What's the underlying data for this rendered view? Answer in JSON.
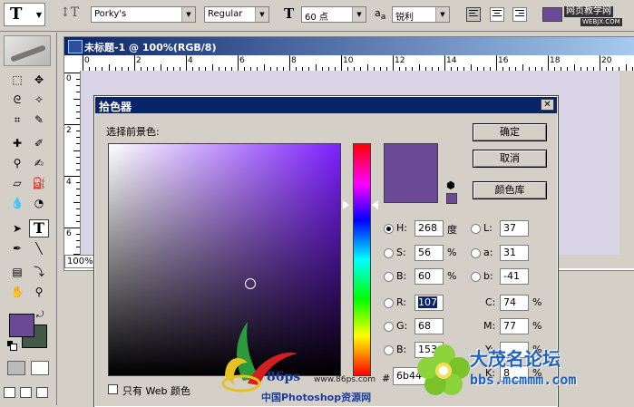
{
  "options_bar": {
    "font_family": "Porky's",
    "font_style": "Regular",
    "font_size": "60 点",
    "antialias": "锐利",
    "text_color": "#6a4a96"
  },
  "watermarks": {
    "top_right": "网页教学网",
    "top_right_url": "WEBJX.COM",
    "ps86_url": "www.86ps.com",
    "ps86_logo": "86ps",
    "ps86_cn": "中国Photoshop资源网",
    "forum_name": "大茂名论坛",
    "forum_url": "bbs.mcmmm.com"
  },
  "document": {
    "title": "未标题-1 @ 100%(RGB/8)",
    "zoom": "100%",
    "ruler_h": [
      "0",
      "2",
      "4",
      "6",
      "8",
      "10",
      "12",
      "14",
      "16",
      "18",
      "20"
    ],
    "ruler_v": [
      "0",
      "2",
      "4",
      "6"
    ]
  },
  "tools": {
    "foreground": "#6a4a96",
    "background": "#44584a"
  },
  "color_picker": {
    "title": "拾色器",
    "prompt": "选择前景色:",
    "ok": "确定",
    "cancel": "取消",
    "libraries": "颜色库",
    "web_only": "只有 Web 颜色",
    "hex_label": "#",
    "hex": "6b44",
    "new_color": "#6a4a96",
    "hsb": [
      {
        "label": "H:",
        "value": "268",
        "unit": "度",
        "selected": true
      },
      {
        "label": "S:",
        "value": "56",
        "unit": "%",
        "selected": false
      },
      {
        "label": "B:",
        "value": "60",
        "unit": "%",
        "selected": false
      }
    ],
    "rgb": [
      {
        "label": "R:",
        "value": "107"
      },
      {
        "label": "G:",
        "value": "68"
      },
      {
        "label": "B:",
        "value": "153"
      }
    ],
    "lab": [
      {
        "label": "L:",
        "value": "37"
      },
      {
        "label": "a:",
        "value": "31"
      },
      {
        "label": "b:",
        "value": "-41"
      }
    ],
    "cmyk": [
      {
        "label": "C:",
        "value": "74",
        "unit": "%"
      },
      {
        "label": "M:",
        "value": "77",
        "unit": "%"
      },
      {
        "label": "Y:",
        "value": "",
        "unit": "%"
      },
      {
        "label": "K:",
        "value": "8",
        "unit": "%"
      }
    ]
  }
}
